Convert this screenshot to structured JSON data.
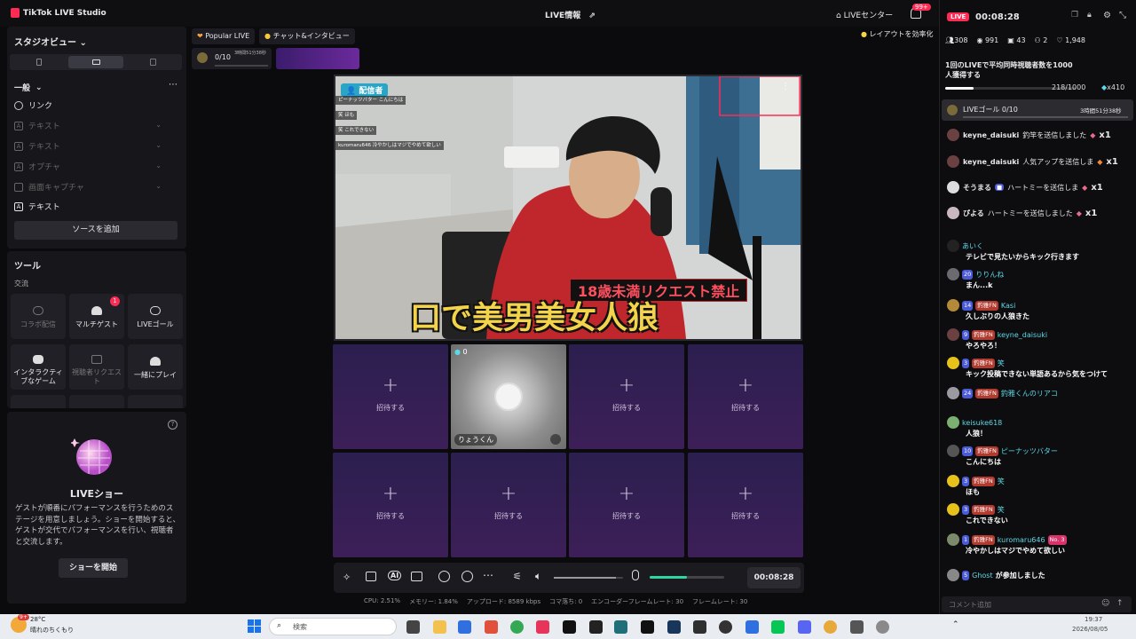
{
  "app": {
    "title": "TikTok LIVE Studio",
    "live_info": "LIVE情報",
    "live_center": "LIVEセンター",
    "notif_badge": "99+"
  },
  "left": {
    "studio_view": "スタジオビュー",
    "section_general": "一般",
    "sources": [
      {
        "label": "リンク",
        "icon": "globe-icon",
        "dim": false
      },
      {
        "label": "テキスト",
        "icon": "text-icon",
        "dim": true
      },
      {
        "label": "テキスト",
        "icon": "text-icon",
        "dim": true
      },
      {
        "label": "オプチャ",
        "icon": "text-icon",
        "dim": true
      },
      {
        "label": "画面キャプチャ",
        "icon": "monitor-icon",
        "dim": true
      },
      {
        "label": "テキスト",
        "icon": "text-icon",
        "dim": false
      }
    ],
    "add_source": "ソースを追加",
    "tools_title": "ツール",
    "tools_sub": "交流",
    "tools": [
      {
        "label": "コラボ配信",
        "icon": "collab-icon",
        "dim": true
      },
      {
        "label": "マルチゲスト",
        "icon": "multiguest-icon",
        "dim": false,
        "badge": "1"
      },
      {
        "label": "LIVEゴール",
        "icon": "goal-icon",
        "dim": false
      },
      {
        "label": "インタラクティブなゲーム",
        "icon": "gamepad-icon",
        "dim": false
      },
      {
        "label": "視聴者リクエスト",
        "icon": "request-icon",
        "dim": true
      },
      {
        "label": "一緒にプレイ",
        "icon": "play-together-icon",
        "dim": false
      }
    ],
    "liveshow": {
      "title": "LIVEショー",
      "desc": "ゲストが順番にパフォーマンスを行うためのステージを用意しましょう。ショーを開始すると、ゲストが交代でパフォーマンスを行い、視聴者と交流します。",
      "button": "ショーを開始"
    }
  },
  "stage": {
    "tabs": [
      "Popular LIVE",
      "チャット&インタビュー"
    ],
    "goal": {
      "count": "0/10",
      "time": "3時間51分38秒"
    },
    "layout_tip": "レイアウトを効率化",
    "video": {
      "host_tag": "配信者",
      "overlay_comments": [
        "ピーナッツバター こんにちは",
        "笑 ほも",
        "笑 これできない",
        "kuromaru646 冷やかしはマジでやめて欲しい"
      ],
      "sub_banner": "18歳未満リクエスト禁止",
      "main_banner": "口で美男美女人狼"
    },
    "invite": "招待する",
    "guest": {
      "name": "りょうくん",
      "count": "0"
    },
    "timer": "00:08:28",
    "volume_level": 0.9,
    "mic_level": 0.5,
    "stats": {
      "cpu": "CPU: 2.51%",
      "mem": "メモリー: 1.84%",
      "upload": "アップロード: 8589 kbps",
      "drops": "コマ落ち: 0",
      "enc_fps": "エンコーダーフレームレート: 30",
      "fps": "フレームレート: 30"
    }
  },
  "right": {
    "live_badge": "LIVE",
    "timer": "00:08:28",
    "stats": {
      "followers": "308",
      "viewers": "991",
      "gifts": "43",
      "guests": "2",
      "likes": "1,948"
    },
    "mission": {
      "text": "1回のLIVEで平均同時視聴者数を1000人獲得する",
      "progress": "218/1000",
      "reward": "x410",
      "fraction": 0.218
    },
    "goal_row": {
      "label": "LIVEゴール 0/10",
      "time": "3時間51分38秒"
    },
    "gifts": [
      {
        "user": "keyne_daisuki",
        "text": "釣竿を送信しました",
        "qty": "x1"
      },
      {
        "user": "keyne_daisuki",
        "text": "人気アップを送信しま",
        "qty": "x1"
      },
      {
        "user": "そうまる",
        "text": "ハートミーを送信しま",
        "qty": "x1"
      },
      {
        "user": "ぴよる",
        "text": "ハートミーを送信しました",
        "qty": "x1"
      }
    ],
    "comments": [
      {
        "user": "あいく",
        "lvl": "",
        "fan": "",
        "text": "テレビで見たいからキック行きます"
      },
      {
        "user": "りりんね",
        "lvl": "20",
        "fan": "",
        "text": "まん...k"
      },
      {
        "user": "Kasi",
        "lvl": "14",
        "fan": "釣雅FN",
        "text": "久しぶりの人狼きた"
      },
      {
        "user": "keyne_daisuki",
        "lvl": "9",
        "fan": "釣雅FN",
        "text": "やろやろ！"
      },
      {
        "user": "笑",
        "lvl": "3",
        "fan": "釣雅FN",
        "text": "キック投稿できない単語あるから気をつけて"
      },
      {
        "user": "釣雅くんのリアコ",
        "lvl": "24",
        "fan": "釣雅FN",
        "text": ""
      },
      {
        "user": "keisuke618",
        "lvl": "",
        "fan": "",
        "text": "人狼！"
      },
      {
        "user": "ピーナッツバター",
        "lvl": "10",
        "fan": "釣雅FN",
        "text": "こんにちは"
      },
      {
        "user": "笑",
        "lvl": "3",
        "fan": "釣雅FN",
        "text": "ほも"
      },
      {
        "user": "笑",
        "lvl": "3",
        "fan": "釣雅FN",
        "text": "これできない"
      },
      {
        "user": "kuromaru646",
        "lvl": "1",
        "fan": "釣雅FN",
        "text": "冷やかしはマジでやめて欲しい",
        "extra": "No. 3"
      },
      {
        "user": "Ghost",
        "lvl": "5",
        "fan": "",
        "text": "",
        "joined": "が参加しました"
      }
    ],
    "comment_placeholder": "コメント追加"
  },
  "taskbar": {
    "weather_temp": "28°C",
    "weather_desc": "晴れのちくもり",
    "weather_badge": "9+",
    "search": "検索",
    "time": "19:37",
    "date": "2026/08/05"
  }
}
